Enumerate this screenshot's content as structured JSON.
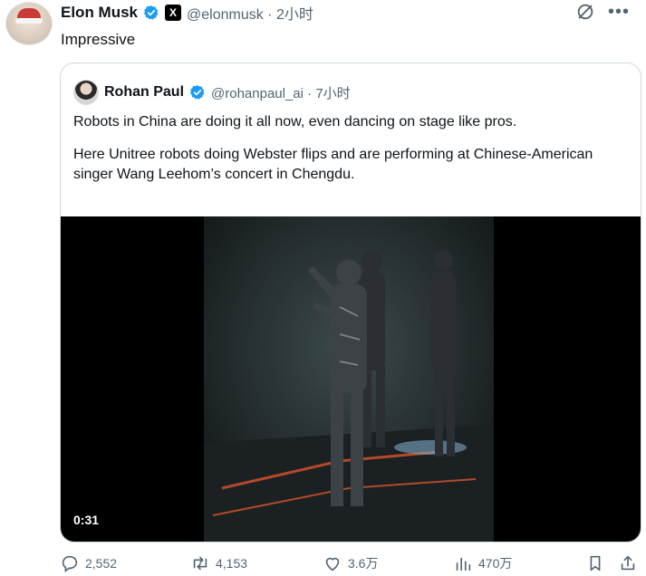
{
  "tweet": {
    "author_name": "Elon Musk",
    "handle_time": "@elonmusk · 2小时",
    "text": "Impressive",
    "x_logo": "X"
  },
  "quote": {
    "author_name": "Rohan Paul",
    "handle_time": "@rohanpaul_ai · 7小时",
    "paragraph1": "Robots in China are doing it all now, even dancing on stage like pros.",
    "paragraph2": "Here Unitree robots doing Webster flips and are performing at Chinese-American singer Wang Leehom’s concert in Chengdu.",
    "video_duration": "0:31"
  },
  "actions": {
    "replies": "2,552",
    "reposts": "4,153",
    "likes": "3.6万",
    "views": "470万"
  },
  "colors": {
    "verified": "#1d9bf0",
    "muted": "#536471",
    "border": "#cfd9de"
  },
  "icons": [
    "verified-badge-icon",
    "x-logo-icon",
    "grok-icon",
    "more-icon",
    "reply-icon",
    "repost-icon",
    "like-icon",
    "views-icon",
    "bookmark-icon"
  ]
}
